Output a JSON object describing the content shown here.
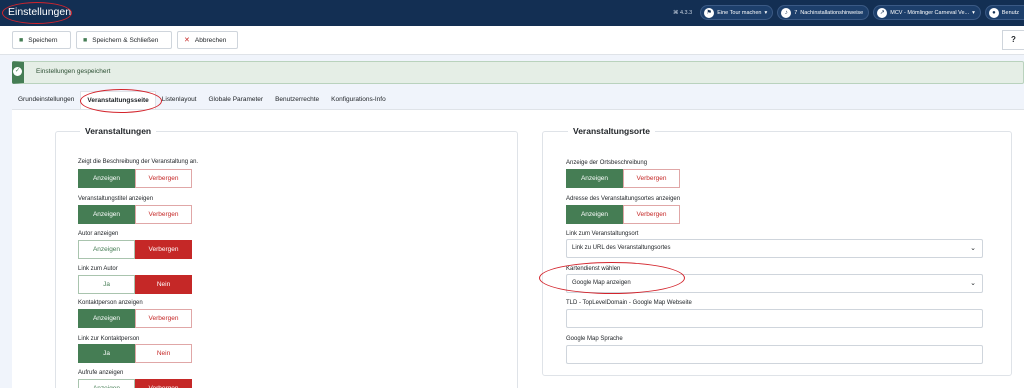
{
  "window": {
    "title": "Einstellungen"
  },
  "header": {
    "version": "⌘ 4.3.3",
    "tour": "Eine Tour machen",
    "notifications_count": "7",
    "notifications_label": "Nachinstallationshinweise",
    "site": "MCV - Mömlinger Carneval Ve...",
    "user": "Benutz"
  },
  "toolbar": {
    "save": "Speichern",
    "save_close": "Speichern & Schließen",
    "cancel": "Abbrechen",
    "help": "?"
  },
  "alert": {
    "message": "Einstellungen gespeichert"
  },
  "tabs": [
    "Grundeinstellungen",
    "Veranstaltungsseite",
    "Listenlayout",
    "Globale Parameter",
    "Benutzerrechte",
    "Konfigurations-Info"
  ],
  "left": {
    "legend": "Veranstaltungen",
    "fields": [
      {
        "label": "Zeigt die Beschreibung der Veranstaltung an.",
        "on": "Anzeigen",
        "off": "Verbergen"
      },
      {
        "label": "Veranstaltungstitel anzeigen",
        "on": "Anzeigen",
        "off": "Verbergen"
      },
      {
        "label": "Autor anzeigen",
        "on": "Anzeigen",
        "off": "Verbergen"
      },
      {
        "label": "Link zum Autor",
        "on": "Ja",
        "off": "Nein"
      },
      {
        "label": "Kontaktperson anzeigen",
        "on": "Anzeigen",
        "off": "Verbergen"
      },
      {
        "label": "Link zur Kontaktperson",
        "on": "Ja",
        "off": "Nein"
      },
      {
        "label": "Aufrufe anzeigen",
        "on": "Anzeigen",
        "off": "Verbergen"
      }
    ]
  },
  "right": {
    "legend": "Veranstaltungsorte",
    "desc_label": "Anzeige der Ortsbeschreibung",
    "desc_on": "Anzeigen",
    "desc_off": "Verbergen",
    "addr_label": "Adresse des Veranstaltungsortes anzeigen",
    "addr_on": "Anzeigen",
    "addr_off": "Verbergen",
    "link_label": "Link zum Veranstaltungsort",
    "link_value": "Link zu URL des Veranstaltungsortes",
    "map_label": "Kartendienst wählen",
    "map_value": "Google Map anzeigen",
    "tld_label": "TLD - TopLevelDomain - Google Map Webseite",
    "tld_value": "",
    "lang_label": "Google Map Sprache",
    "lang_value": ""
  },
  "colors": {
    "header": "#132f53",
    "success": "#457d54",
    "danger": "#c52827",
    "annotation": "#d3242c"
  }
}
